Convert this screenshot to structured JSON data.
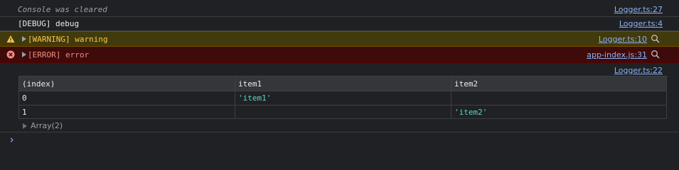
{
  "messages": {
    "cleared": {
      "text": "Console was cleared",
      "source": "Logger.ts:27"
    },
    "debug": {
      "text": "[DEBUG] debug",
      "source": "Logger.ts:4"
    },
    "warning": {
      "text": "[WARNING] warning",
      "source": "Logger.ts:10",
      "icon": "warning-triangle-icon",
      "color": "#f9c74f"
    },
    "error": {
      "text": "[ERROR] error",
      "source": "app-index.js:31",
      "icon": "error-circle-icon",
      "color": "#f28b82"
    }
  },
  "table_log": {
    "source": "Logger.ts:22",
    "columns": [
      "(index)",
      "item1",
      "item2"
    ],
    "rows": [
      {
        "index": "0",
        "item1": "'item1'",
        "item2": ""
      },
      {
        "index": "1",
        "item1": "",
        "item2": "'item2'"
      }
    ],
    "summary": "Array(2)"
  },
  "prompt": {
    "symbol": "›"
  },
  "colors": {
    "background": "#202124",
    "link": "#8ab4f8",
    "string": "#5cd5c4",
    "warning_bg": "#413a0c",
    "error_bg": "#3e0a0a"
  }
}
